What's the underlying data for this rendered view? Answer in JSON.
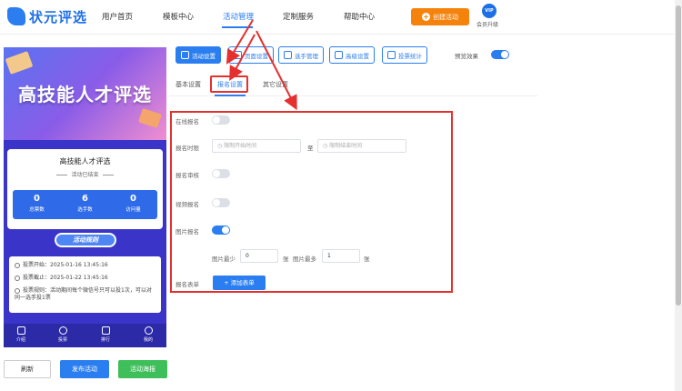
{
  "app": {
    "logo_text": "状元评选"
  },
  "nav": {
    "items": [
      "用户首页",
      "模板中心",
      "活动管理",
      "定制服务",
      "帮助中心"
    ],
    "create_button": "创建活动",
    "vip_badge": "VIP",
    "vip_label": "会员升级"
  },
  "preview": {
    "banner_title": "高技能人才评选",
    "card_title": "高技能人才评选",
    "status": "活动已结束",
    "stats": [
      {
        "num": "0",
        "label": "总票数"
      },
      {
        "num": "6",
        "label": "选手数"
      },
      {
        "num": "0",
        "label": "访问量"
      }
    ],
    "rules_label": "活动规则",
    "rules": [
      "投票开始：2025-01-16 13:45:16",
      "投票截止：2025-01-22 13:45:16",
      "投票规则：活动期间每个微信号只可以投1次，可以对同一选手投1票"
    ],
    "bottom_nav": [
      "介绍",
      "投票",
      "排行",
      "我的"
    ]
  },
  "bottom_buttons": {
    "refresh": "刷新",
    "publish": "发布活动",
    "poster": "活动海报"
  },
  "toolbar": {
    "items": [
      "活动设置",
      "页面设置",
      "选手管理",
      "高级设置",
      "投票统计"
    ],
    "preview_label": "预览效果"
  },
  "tabs": [
    "基本设置",
    "报名设置",
    "其它设置"
  ],
  "form": {
    "online_signup": "在线报名",
    "signup_time": "报名时限",
    "start_placeholder": "限制开始时间",
    "to": "至",
    "end_placeholder": "限制结束时间",
    "signup_review": "报名审核",
    "video_signup": "视频报名",
    "image_signup": "图片报名",
    "image_min_label": "图片最少",
    "image_min_value": "0",
    "image_unit": "张",
    "image_max_label": "图片最多",
    "image_max_value": "1",
    "form_label": "报名表单",
    "add_form_button": "+ 添加表单"
  },
  "colors": {
    "accent": "#2a7ef0",
    "highlight": "#e53030",
    "orange": "#f5820b",
    "green": "#3fbf5a"
  }
}
